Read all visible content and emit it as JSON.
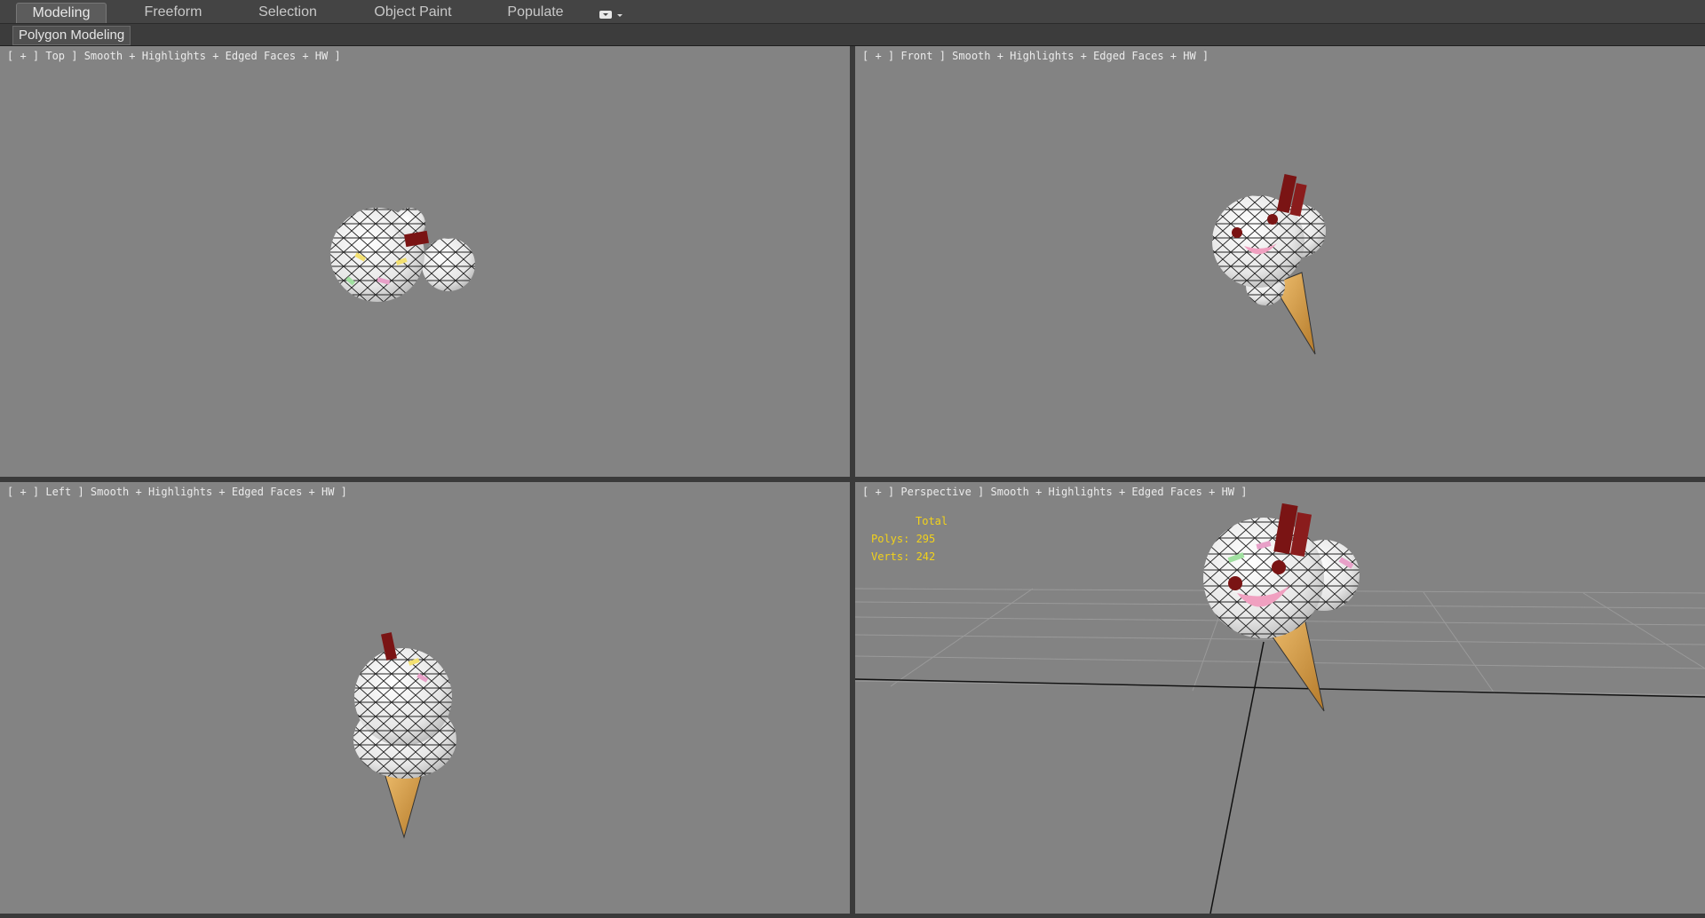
{
  "ribbon": {
    "tabs": [
      {
        "label": "Modeling",
        "active": true
      },
      {
        "label": "Freeform",
        "active": false
      },
      {
        "label": "Selection",
        "active": false
      },
      {
        "label": "Object Paint",
        "active": false
      },
      {
        "label": "Populate",
        "active": false
      }
    ],
    "extra_icon": "ribbon-options-icon",
    "panel_label": "Polygon Modeling"
  },
  "viewports": {
    "top": {
      "label": "[ + ] Top ] Smooth + Highlights + Edged Faces + HW ]"
    },
    "front": {
      "label": "[ + ] Front ] Smooth + Highlights + Edged Faces + HW ]"
    },
    "left": {
      "label": "[ + ] Left ] Smooth + Highlights + Edged Faces + HW ]"
    },
    "perspective": {
      "label": "[ + ] Perspective ] Smooth + Highlights + Edged Faces + HW ]",
      "stats": {
        "total_label": "Total",
        "polys": "Polys: 295",
        "verts": "Verts: 242"
      }
    }
  },
  "colors": {
    "viewport_bg": "#838383",
    "stats_text": "#f2d21a",
    "chocolate": "#7a1414",
    "cone": "#d9a04a",
    "cheek": "#f0a0c0"
  }
}
